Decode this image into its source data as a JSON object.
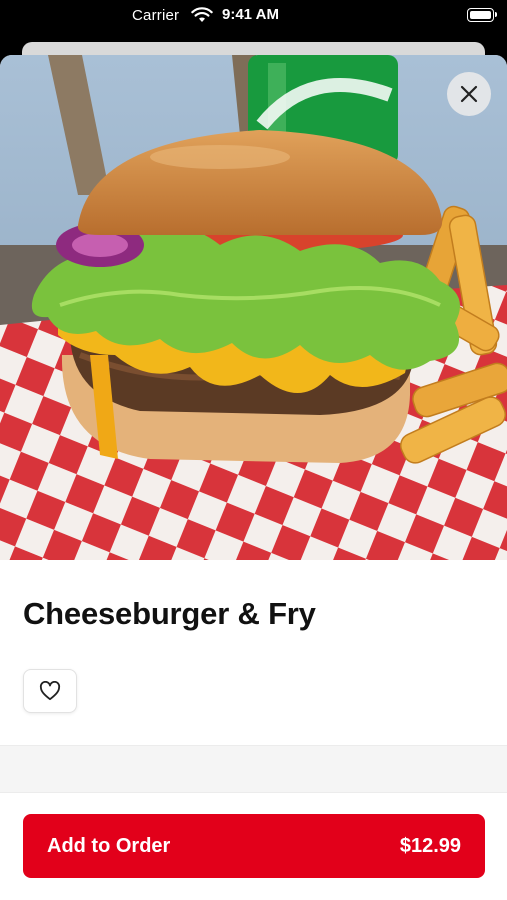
{
  "status_bar": {
    "carrier": "Carrier",
    "time": "9:41 AM"
  },
  "product": {
    "title": "Cheeseburger & Fry",
    "image": "cheeseburger-and-fries-photo"
  },
  "actions": {
    "add_label": "Add to Order",
    "price": "$12.99"
  },
  "icons": {
    "close": "close-icon",
    "favorite": "heart-icon",
    "wifi": "wifi-icon",
    "battery": "battery-icon"
  },
  "colors": {
    "accent": "#e2001a"
  }
}
